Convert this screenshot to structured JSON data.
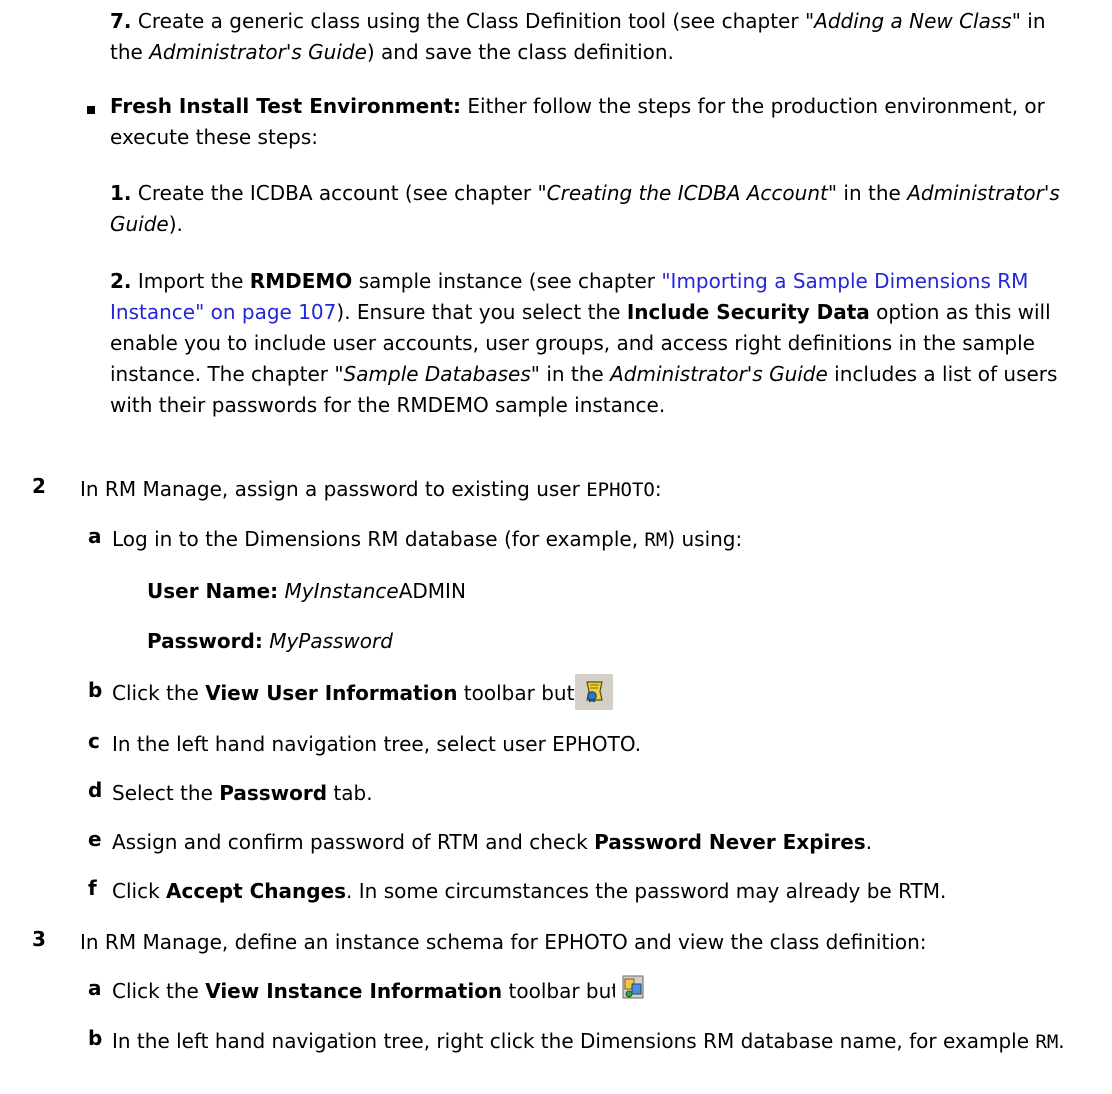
{
  "intro_step7": {
    "num": "7.",
    "t1": " Create a generic class using the Class Definition tool (see chapter ",
    "chapter": "\"Adding a New Class\"",
    "t2": " in the ",
    "guide": "Administrator's Guide",
    "t3": ") and save the class definition."
  },
  "fresh_install": {
    "label": "Fresh Install Test Environment:",
    "text": " Either follow the steps for the production environment, or execute these steps:",
    "step1": {
      "num": "1.",
      "t1": " Create the ICDBA account (see chapter ",
      "chapter": "\"Creating the ICDBA Account",
      "t2": "\" in the ",
      "guide": "Administrator's Guide",
      "t3": ")."
    },
    "step2": {
      "num": "2.",
      "t1": " Import the ",
      "rmdemo": "RMDEMO",
      "t2": " sample instance (see chapter ",
      "link": "\"Importing a Sample Dimensions RM Instance\" on page 107",
      "t3": "). Ensure that you select the ",
      "option": "Include Security Data",
      "t4": " option as this will enable you to include user accounts, user groups, and access right definitions in the sample instance. The chapter ",
      "chapter": "\"Sample Databases\"",
      "t5": " in the ",
      "guide": "Administrator's Guide",
      "t6": " includes a list of users with their passwords for the RMDEMO sample instance."
    }
  },
  "step2": {
    "num": "2",
    "t1": "In RM Manage, assign a password to existing user ",
    "code": "EPHOTO",
    "t2": ":",
    "a": {
      "lbl": "a",
      "t1": "Log in to the Dimensions RM database (for example, ",
      "code": "RM",
      "t2": ") using:",
      "username_label": "User Name:",
      "username_italic": "MyInstance",
      "username_rest": "ADMIN",
      "password_label": "Password:",
      "password_value": "MyPassword"
    },
    "b": {
      "lbl": "b",
      "t1": "Click the ",
      "bold": "View User Information",
      "t2": " toolbar button",
      "icon": "view-user-information-icon"
    },
    "c": {
      "lbl": "c",
      "text": "In the left hand navigation tree, select user EPHOTO."
    },
    "d": {
      "lbl": "d",
      "t1": "Select the ",
      "bold": "Password",
      "t2": " tab."
    },
    "e": {
      "lbl": "e",
      "t1": "Assign and confirm password of RTM and check ",
      "bold": "Password Never Expires",
      "t2": "."
    },
    "f": {
      "lbl": "f",
      "t1": "Click ",
      "bold": "Accept Changes",
      "t2": ". In some circumstances the password may already be RTM."
    }
  },
  "step3": {
    "num": "3",
    "text": "In RM Manage, define an instance schema for EPHOTO and view the class definition:",
    "a": {
      "lbl": "a",
      "t1": "Click the ",
      "bold": "View Instance Information",
      "t2": " toolbar button",
      "icon": "view-instance-information-icon"
    },
    "b": {
      "lbl": "b",
      "t1": "In the left hand navigation tree, right click the Dimensions RM database name, for example ",
      "code": "RM",
      "t2": "."
    }
  },
  "colors": {
    "link": "#2426d9",
    "icon_bg": "#d4d0c8"
  }
}
